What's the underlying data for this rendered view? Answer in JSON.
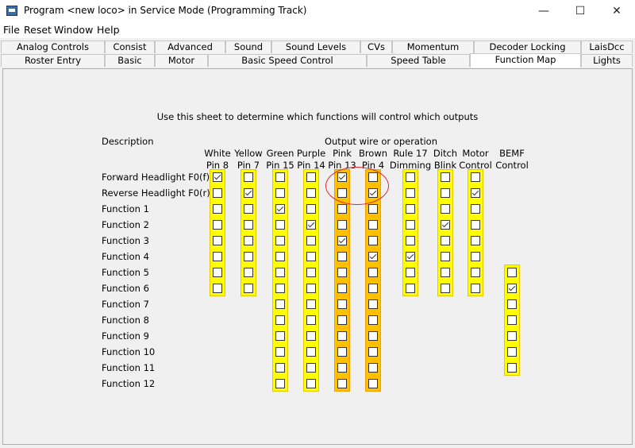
{
  "window": {
    "title": "Program <new loco> in Service Mode (Programming Track)",
    "minimize": "—",
    "maximize": "☐",
    "close": "✕"
  },
  "menu": [
    "File",
    "Reset",
    "Window",
    "Help"
  ],
  "tabs_row1": [
    "Analog Controls",
    "Consist",
    "Advanced",
    "Sound",
    "Sound Levels",
    "CVs",
    "Momentum",
    "Decoder Locking",
    "LaisDcc"
  ],
  "tabs_row2": [
    "Roster Entry",
    "Basic",
    "Motor",
    "Basic Speed Control",
    "Speed Table",
    "Function Map",
    "Lights"
  ],
  "active_tab": "Function Map",
  "sheet": {
    "instruction": "Use this sheet to determine which functions will control which outputs",
    "description_header": "Description",
    "output_header": "Output wire or operation",
    "columns": [
      {
        "line1": "White",
        "line2": "Pin 8"
      },
      {
        "line1": "Yellow",
        "line2": "Pin 7"
      },
      {
        "line1": "Green",
        "line2": "Pin 15"
      },
      {
        "line1": "Purple",
        "line2": "Pin 14"
      },
      {
        "line1": "Pink",
        "line2": "Pin 13"
      },
      {
        "line1": "Brown",
        "line2": "Pin 4"
      },
      {
        "line1": "Rule 17",
        "line2": "Dimming"
      },
      {
        "line1": "Ditch",
        "line2": "Blink"
      },
      {
        "line1": "Motor",
        "line2": "Control"
      },
      {
        "line1": "BEMF",
        "line2": "Control"
      }
    ],
    "rows": [
      "Forward Headlight F0(f)",
      "Reverse Headlight F0(r)",
      "Function 1",
      "Function 2",
      "Function 3",
      "Function 4",
      "Function 5",
      "Function 6",
      "Function 7",
      "Function 8",
      "Function 9",
      "Function 10",
      "Function 11",
      "Function 12"
    ],
    "column_row_counts": [
      8,
      8,
      14,
      14,
      14,
      14,
      8,
      8,
      8,
      7
    ],
    "column_row_start": [
      0,
      0,
      0,
      0,
      0,
      0,
      0,
      0,
      0,
      6
    ],
    "highlighted_columns": [
      4,
      5
    ],
    "checked": [
      [
        0,
        0
      ],
      [
        0,
        4
      ],
      [
        1,
        1
      ],
      [
        1,
        5
      ],
      [
        1,
        8
      ],
      [
        2,
        2
      ],
      [
        3,
        3
      ],
      [
        3,
        7
      ],
      [
        4,
        4
      ],
      [
        5,
        5
      ],
      [
        5,
        6
      ],
      [
        7,
        9
      ]
    ],
    "colors": {
      "highlight": "#ffff00",
      "highlight_orange": "#ffc000",
      "annotation": "#e0262c"
    }
  }
}
